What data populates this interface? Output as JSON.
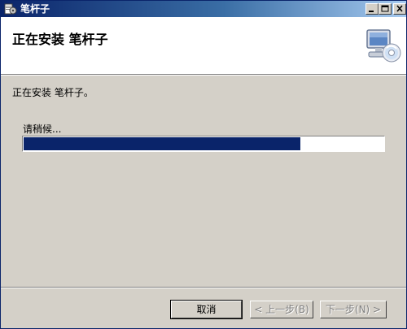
{
  "window": {
    "title": "笔杆子",
    "controls": [
      "minimize-icon",
      "maximize-icon",
      "close-icon"
    ]
  },
  "header": {
    "title": "正在安装  笔杆子",
    "icon": "computer-cd-icon"
  },
  "main": {
    "status_text": "正在安装 笔杆子。",
    "wait_text": "请稍候...",
    "progress_percent": 77
  },
  "buttons": {
    "cancel_label": "取消",
    "back_label": "< 上一步(B)",
    "next_label": "下一步(N) >"
  },
  "colors": {
    "titlebar_start": "#0a246a",
    "titlebar_end": "#a6caf0",
    "progress_fill": "#0a246a",
    "dialog_bg": "#d4d0c8"
  }
}
